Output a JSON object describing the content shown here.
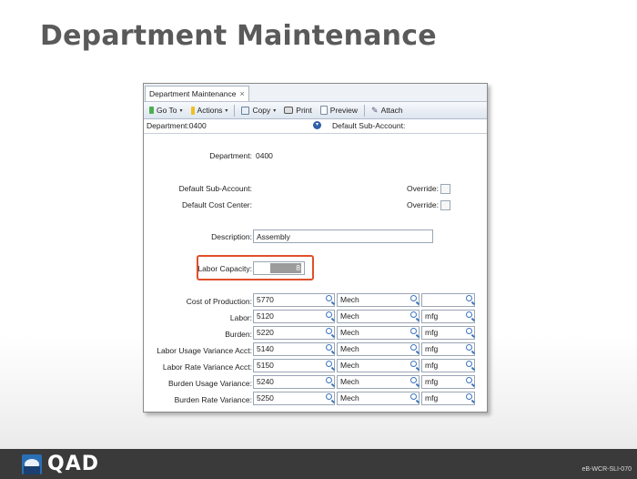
{
  "slide": {
    "title": "Department Maintenance",
    "footer_code": "eB-WCR-SLI-070",
    "logo_text": "QAD",
    "footer_bg": "#3a3a3a"
  },
  "window": {
    "tab_label": "Department Maintenance",
    "tab_close": "×",
    "toolbar": {
      "goto_label": "Go To",
      "actions_label": "Actions",
      "copy_label": "Copy",
      "print_label": "Print",
      "preview_label": "Preview",
      "attach_label": "Attach",
      "caret": "▾"
    },
    "header": {
      "department": "Department:0400",
      "default_sub_account": "Default Sub-Account:",
      "collapse_glyph": "▾"
    }
  },
  "form": {
    "department_label": "Department:",
    "department_value": "0400",
    "default_sub_account_label": "Default Sub-Account:",
    "default_cost_center_label": "Default Cost Center:",
    "override_label": "Override:",
    "description_label": "Description:",
    "description_value": "Assembly",
    "labor_capacity_label": "Labor Capacity:",
    "labor_capacity_value": "8",
    "highlight_color": "#e0502a",
    "rows": [
      {
        "label": "Cost of Production:",
        "account": "5770",
        "cost_center": "Mech",
        "sub": ""
      },
      {
        "label": "Labor:",
        "account": "5120",
        "cost_center": "Mech",
        "sub": "mfg"
      },
      {
        "label": "Burden:",
        "account": "5220",
        "cost_center": "Mech",
        "sub": "mfg"
      },
      {
        "label": "Labor Usage Variance Acct:",
        "account": "5140",
        "cost_center": "Mech",
        "sub": "mfg"
      },
      {
        "label": "Labor Rate Variance Acct:",
        "account": "5150",
        "cost_center": "Mech",
        "sub": "mfg"
      },
      {
        "label": "Burden Usage Variance:",
        "account": "5240",
        "cost_center": "Mech",
        "sub": "mfg"
      },
      {
        "label": "Burden Rate Variance:",
        "account": "5250",
        "cost_center": "Mech",
        "sub": "mfg"
      }
    ]
  }
}
